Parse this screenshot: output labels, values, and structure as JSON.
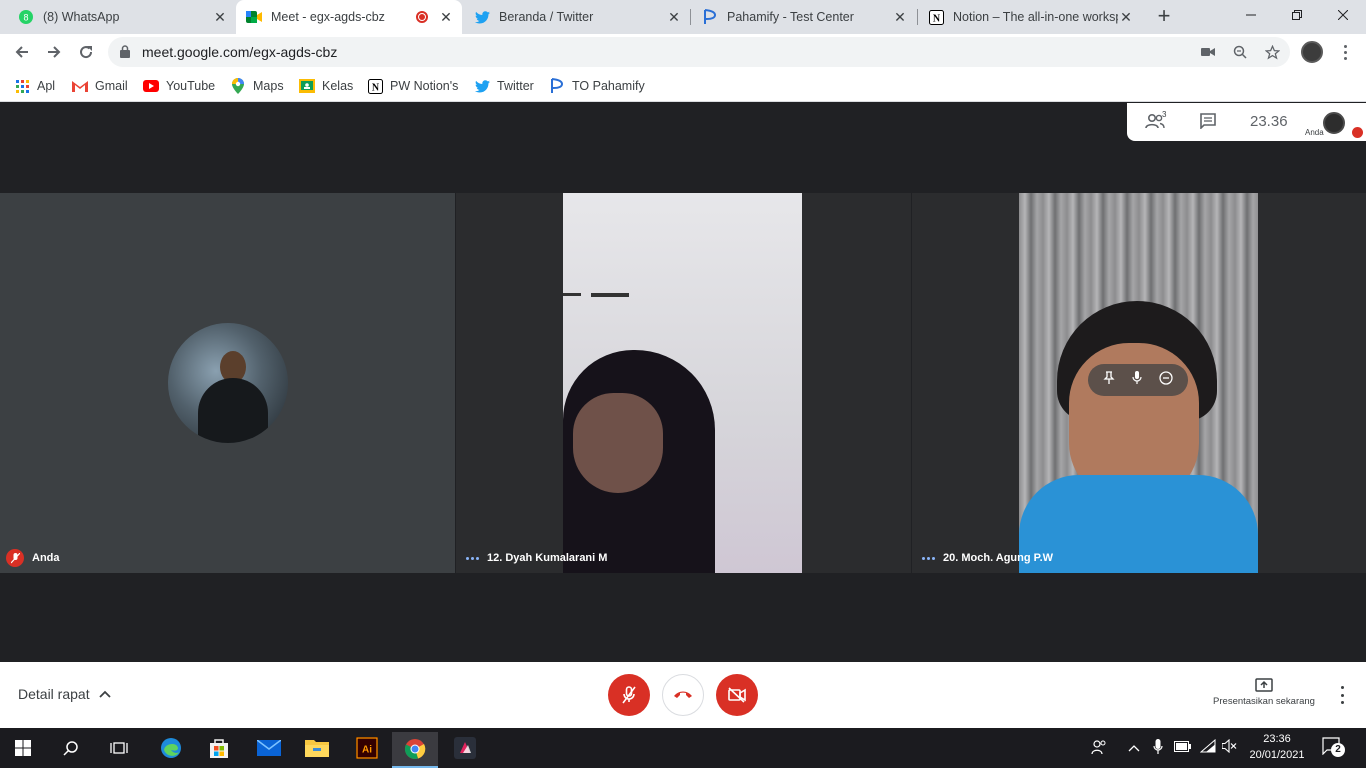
{
  "browser": {
    "tabs": [
      {
        "title": "(8) WhatsApp",
        "icon": "whatsapp-icon",
        "active": false
      },
      {
        "title": "Meet - egx-agds-cbz",
        "icon": "google-meet-icon",
        "active": true,
        "recording": true
      },
      {
        "title": "Beranda / Twitter",
        "icon": "twitter-icon",
        "active": false
      },
      {
        "title": "Pahamify - Test Center",
        "icon": "pahamify-icon",
        "active": false
      },
      {
        "title": "Notion – The all-in-one worksp",
        "icon": "notion-icon",
        "active": false
      }
    ],
    "url": "meet.google.com/egx-agds-cbz",
    "bookmarks": [
      {
        "label": "Apl",
        "icon": "apps-grid-icon"
      },
      {
        "label": "Gmail",
        "icon": "gmail-icon"
      },
      {
        "label": "YouTube",
        "icon": "youtube-icon"
      },
      {
        "label": "Maps",
        "icon": "maps-icon"
      },
      {
        "label": "Kelas",
        "icon": "classroom-icon"
      },
      {
        "label": "PW Notion's",
        "icon": "notion-icon"
      },
      {
        "label": "Twitter",
        "icon": "twitter-icon"
      },
      {
        "label": "TO Pahamify",
        "icon": "pahamify-icon"
      }
    ]
  },
  "meet": {
    "participants_count": "3",
    "time": "23.36",
    "self_label": "Anda",
    "tiles": [
      {
        "name": "Anda",
        "muted": true
      },
      {
        "name": "12. Dyah Kumalarani M",
        "muted": false
      },
      {
        "name": "20. Moch. Agung P.W",
        "muted": false
      }
    ],
    "meeting_details": "Detail rapat",
    "present_label": "Presentasikan sekarang"
  },
  "taskbar": {
    "time": "23:36",
    "date": "20/01/2021",
    "notifications": "2"
  },
  "colors": {
    "meet_bg": "#202124",
    "danger": "#d93025",
    "accent_blue": "#8ab4f8"
  }
}
